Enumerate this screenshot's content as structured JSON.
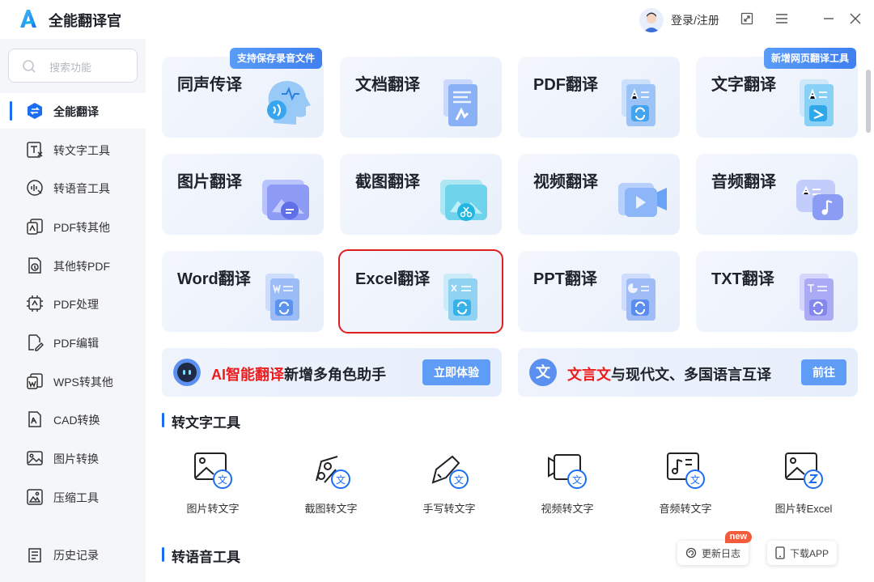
{
  "app": {
    "title": "全能翻译官"
  },
  "header": {
    "login_label": "登录/注册"
  },
  "sidebar": {
    "search_placeholder": "搜索功能",
    "items": [
      {
        "label": "全能翻译",
        "icon": "translate-icon",
        "active": true
      },
      {
        "label": "转文字工具",
        "icon": "text-convert-icon"
      },
      {
        "label": "转语音工具",
        "icon": "voice-icon"
      },
      {
        "label": "PDF转其他",
        "icon": "pdf-convert-icon"
      },
      {
        "label": "其他转PDF",
        "icon": "to-pdf-icon"
      },
      {
        "label": "PDF处理",
        "icon": "pdf-process-icon"
      },
      {
        "label": "PDF编辑",
        "icon": "pdf-edit-icon"
      },
      {
        "label": "WPS转其他",
        "icon": "wps-icon"
      },
      {
        "label": "CAD转换",
        "icon": "cad-icon"
      },
      {
        "label": "图片转换",
        "icon": "image-convert-icon"
      },
      {
        "label": "压缩工具",
        "icon": "compress-icon"
      }
    ],
    "history_label": "历史记录"
  },
  "cards": [
    {
      "title": "同声传译",
      "tag": "支持保存录音文件",
      "icon": "head-voice-icon"
    },
    {
      "title": "文档翻译",
      "icon": "document-icon"
    },
    {
      "title": "PDF翻译",
      "icon": "pdf-file-icon"
    },
    {
      "title": "文字翻译",
      "tag": "新增网页翻译工具",
      "icon": "text-file-icon"
    },
    {
      "title": "图片翻译",
      "icon": "image-icon"
    },
    {
      "title": "截图翻译",
      "icon": "screenshot-icon"
    },
    {
      "title": "视频翻译",
      "icon": "video-icon"
    },
    {
      "title": "音频翻译",
      "icon": "audio-icon"
    },
    {
      "title": "Word翻译",
      "icon": "word-file-icon"
    },
    {
      "title": "Excel翻译",
      "icon": "excel-file-icon",
      "highlighted": true
    },
    {
      "title": "PPT翻译",
      "icon": "ppt-file-icon"
    },
    {
      "title": "TXT翻译",
      "icon": "txt-file-icon"
    }
  ],
  "banners": [
    {
      "highlight": "AI智能翻译",
      "text": "新增多角色助手",
      "button": "立即体验"
    },
    {
      "highlight": "文言文",
      "text": "与现代文、多国语言互译",
      "button": "前往",
      "icon_char": "文"
    }
  ],
  "sections": {
    "text_tools": "转文字工具",
    "voice_tools": "转语音工具"
  },
  "text_tools": [
    {
      "label": "图片转文字",
      "icon": "image-to-text-icon"
    },
    {
      "label": "截图转文字",
      "icon": "screenshot-to-text-icon"
    },
    {
      "label": "手写转文字",
      "icon": "handwriting-to-text-icon"
    },
    {
      "label": "视频转文字",
      "icon": "video-to-text-icon"
    },
    {
      "label": "音频转文字",
      "icon": "audio-to-text-icon"
    },
    {
      "label": "图片转Excel",
      "icon": "image-to-excel-icon"
    }
  ],
  "footer_buttons": {
    "changelog": "更新日志",
    "changelog_badge": "new",
    "download": "下载APP"
  },
  "colors": {
    "accent": "#1b6ef3",
    "highlight_red": "#ec1c1c",
    "button_blue": "#5f9cf5"
  }
}
